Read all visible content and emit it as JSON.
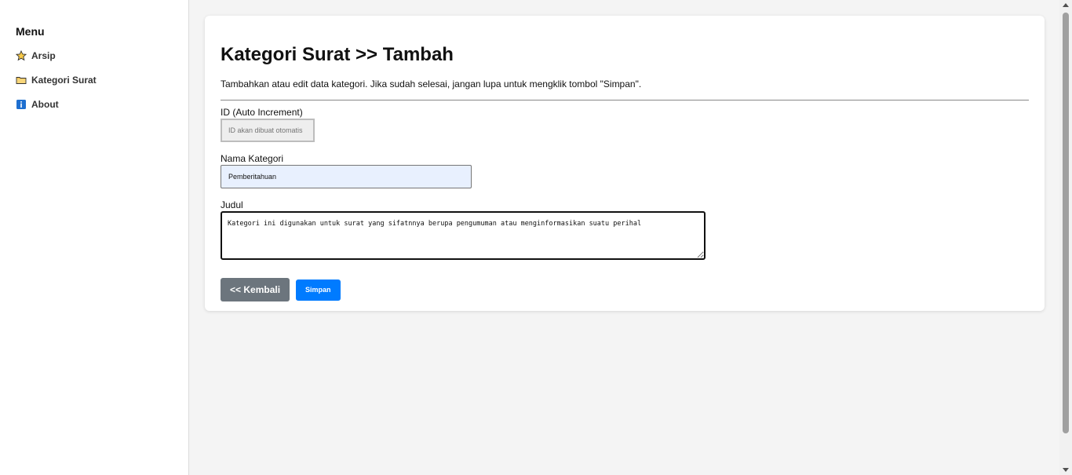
{
  "sidebar": {
    "title": "Menu",
    "items": [
      {
        "label": "Arsip",
        "icon": "star-icon"
      },
      {
        "label": "Kategori Surat",
        "icon": "folder-icon"
      },
      {
        "label": "About",
        "icon": "info-icon"
      }
    ]
  },
  "main": {
    "title": "Kategori Surat >> Tambah",
    "description": "Tambahkan atau edit data kategori. Jika sudah selesai, jangan lupa untuk mengklik tombol \"Simpan\".",
    "id_field": {
      "label": "ID (Auto Increment)",
      "placeholder": "ID akan dibuat otomatis"
    },
    "name_field": {
      "label": "Nama Kategori",
      "value": "Pemberitahuan"
    },
    "judul_field": {
      "label": "Judul",
      "value": "Kategori ini digunakan untuk surat yang sifatnnya berupa pengumuman atau menginformasikan suatu perihal"
    },
    "buttons": {
      "back": "<< Kembali",
      "save": "Simpan"
    }
  },
  "colors": {
    "primary": "#007bff",
    "secondary": "#6c757d",
    "autofill_bg": "#e8f0fe"
  }
}
